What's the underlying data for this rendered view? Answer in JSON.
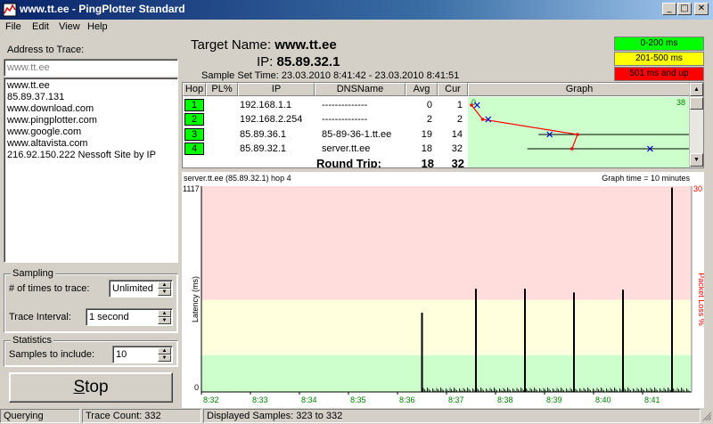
{
  "window": {
    "title": "www.tt.ee - PingPlotter Standard"
  },
  "menu": [
    "File",
    "Edit",
    "View",
    "Help"
  ],
  "address": {
    "label": "Address to Trace:",
    "input_value": "www.tt.ee",
    "history": [
      "www.tt.ee",
      "85.89.37.131",
      "www.download.com",
      "www.pingplotter.com",
      "www.google.com",
      "www.altavista.com",
      "216.92.150.222 Nessoft Site by IP"
    ]
  },
  "sampling": {
    "title": "Sampling",
    "times_label": "# of times to trace:",
    "times_value": "Unlimited",
    "interval_label": "Trace Interval:",
    "interval_value": "1 second"
  },
  "statistics": {
    "title": "Statistics",
    "samples_label": "Samples to include:",
    "samples_value": "10"
  },
  "stop_button": {
    "prefix": "S",
    "rest": "top"
  },
  "target": {
    "name_label": "Target Name:",
    "name": "www.tt.ee",
    "ip_label": "IP:",
    "ip": "85.89.32.1",
    "sample_time_label": "Sample Set Time:",
    "sample_time": "23.03.2010 8:41:42 - 23.03.2010 8:41:51"
  },
  "legend": [
    {
      "label": "0-200 ms",
      "color": "#00ff00",
      "text_color": "#000000"
    },
    {
      "label": "201-500 ms",
      "color": "#ffff00",
      "text_color": "#000000"
    },
    {
      "label": "501 ms and up",
      "color": "#ff0000",
      "text_color": "#000000"
    }
  ],
  "table": {
    "columns": [
      "Hop",
      "PL%",
      "IP",
      "DNSName",
      "Avg",
      "Cur",
      "Graph"
    ],
    "rows": [
      {
        "hop": "1",
        "pl": "",
        "ip": "192.168.1.1",
        "dns": "--------------",
        "avg": "0",
        "cur": "1"
      },
      {
        "hop": "2",
        "pl": "",
        "ip": "192.168.2.254",
        "dns": "--------------",
        "avg": "2",
        "cur": "2"
      },
      {
        "hop": "3",
        "pl": "",
        "ip": "85.89.36.1",
        "dns": "85-89-36-1.tt.ee",
        "avg": "19",
        "cur": "14"
      },
      {
        "hop": "4",
        "pl": "",
        "ip": "85.89.32.1",
        "dns": "server.tt.ee",
        "avg": "18",
        "cur": "32"
      }
    ],
    "round_trip_label": "Round Trip:",
    "round_trip_avg": "18",
    "round_trip_cur": "32",
    "graph_scale_min": "0",
    "graph_scale_max": "38"
  },
  "mini_graph": {
    "range": [
      0,
      38
    ],
    "avg_points": [
      0,
      2,
      19,
      18
    ],
    "markers": [
      {
        "hop": 1,
        "value": 1
      },
      {
        "hop": 2,
        "value": 3
      },
      {
        "hop": 3,
        "value": 14
      },
      {
        "hop": 4,
        "value": 32
      }
    ],
    "ranges": [
      {
        "hop": 3,
        "min": 12,
        "max": 38
      },
      {
        "hop": 4,
        "min": 10,
        "max": 36
      }
    ]
  },
  "chart_data": {
    "type": "line",
    "title": "server.tt.ee (85.89.32.1) hop 4",
    "graph_time_label": "Graph time = 10 minutes",
    "ylabel": "Latency (ms)",
    "y2label": "Packet Loss %",
    "ylim": [
      0,
      1117
    ],
    "y_ticks": [
      "1117",
      "0"
    ],
    "y2_ticks": [
      "30"
    ],
    "x_ticks": [
      "8:32",
      "8:33",
      "8:34",
      "8:35",
      "8:36",
      "8:37",
      "8:38",
      "8:39",
      "8:40",
      "8:41"
    ],
    "x_range_minutes": [
      0,
      10
    ],
    "bands": [
      {
        "from": 0,
        "to": 200,
        "color": "#ccffcc"
      },
      {
        "from": 200,
        "to": 500,
        "color": "#ffffdd"
      },
      {
        "from": 500,
        "to": 1117,
        "color": "#ffdddd"
      }
    ],
    "spikes": [
      {
        "minute": 4.5,
        "value": 430
      },
      {
        "minute": 5.6,
        "value": 560
      },
      {
        "minute": 6.6,
        "value": 560
      },
      {
        "minute": 7.6,
        "value": 540
      },
      {
        "minute": 8.6,
        "value": 555
      },
      {
        "minute": 9.6,
        "value": 1110
      }
    ],
    "baseline_start_minute": 4.5,
    "baseline_value": 12
  },
  "statusbar": {
    "state": "Querying",
    "trace_count": "Trace Count: 332",
    "displayed": "Displayed Samples: 323 to 332"
  }
}
